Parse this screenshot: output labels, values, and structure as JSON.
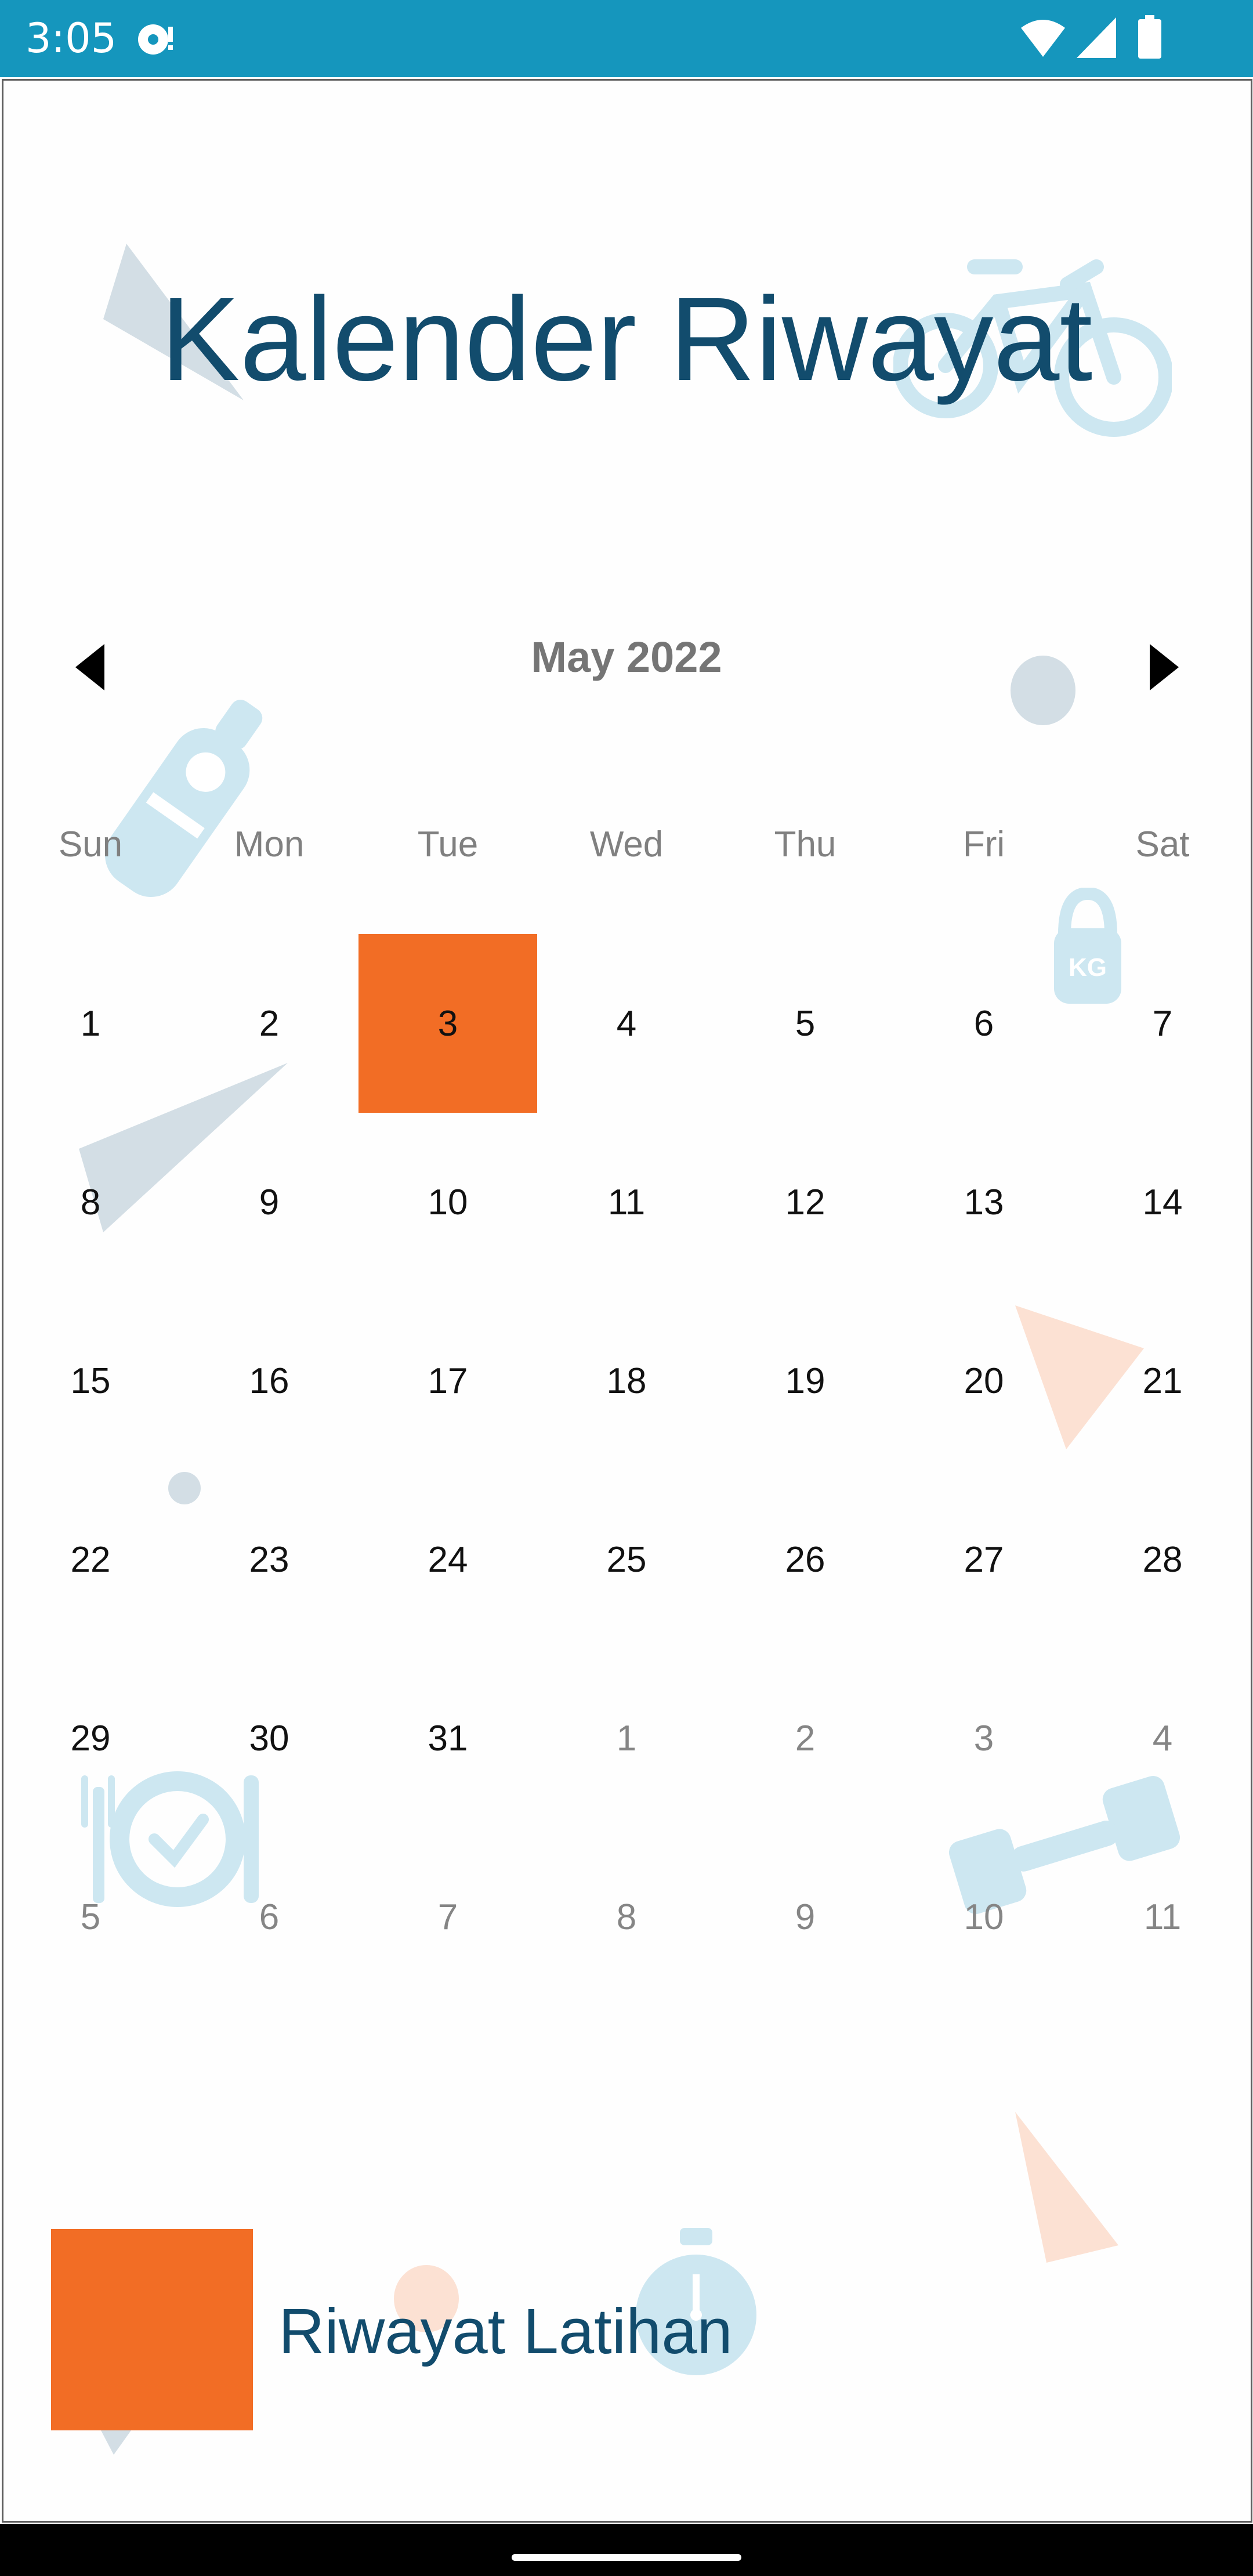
{
  "status_bar": {
    "time": "3:05",
    "icons": [
      "media-indicator-icon",
      "wifi-icon",
      "signal-icon",
      "battery-icon"
    ],
    "background": "#1596bd"
  },
  "page": {
    "title": "Kalender Riwayat"
  },
  "calendar": {
    "month_label": "May 2022",
    "prev_icon": "chevron-left-icon",
    "next_icon": "chevron-right-icon",
    "weekdays": [
      "Sun",
      "Mon",
      "Tue",
      "Wed",
      "Thu",
      "Fri",
      "Sat"
    ],
    "selected_day": "3",
    "selected_color": "#f26d25",
    "weeks": [
      [
        {
          "d": "1",
          "o": false
        },
        {
          "d": "2",
          "o": false
        },
        {
          "d": "3",
          "o": false
        },
        {
          "d": "4",
          "o": false
        },
        {
          "d": "5",
          "o": false
        },
        {
          "d": "6",
          "o": false
        },
        {
          "d": "7",
          "o": false
        }
      ],
      [
        {
          "d": "8",
          "o": false
        },
        {
          "d": "9",
          "o": false
        },
        {
          "d": "10",
          "o": false
        },
        {
          "d": "11",
          "o": false
        },
        {
          "d": "12",
          "o": false
        },
        {
          "d": "13",
          "o": false
        },
        {
          "d": "14",
          "o": false
        }
      ],
      [
        {
          "d": "15",
          "o": false
        },
        {
          "d": "16",
          "o": false
        },
        {
          "d": "17",
          "o": false
        },
        {
          "d": "18",
          "o": false
        },
        {
          "d": "19",
          "o": false
        },
        {
          "d": "20",
          "o": false
        },
        {
          "d": "21",
          "o": false
        }
      ],
      [
        {
          "d": "22",
          "o": false
        },
        {
          "d": "23",
          "o": false
        },
        {
          "d": "24",
          "o": false
        },
        {
          "d": "25",
          "o": false
        },
        {
          "d": "26",
          "o": false
        },
        {
          "d": "27",
          "o": false
        },
        {
          "d": "28",
          "o": false
        }
      ],
      [
        {
          "d": "29",
          "o": false
        },
        {
          "d": "30",
          "o": false
        },
        {
          "d": "31",
          "o": false
        },
        {
          "d": "1",
          "o": true
        },
        {
          "d": "2",
          "o": true
        },
        {
          "d": "3",
          "o": true
        },
        {
          "d": "4",
          "o": true
        }
      ],
      [
        {
          "d": "5",
          "o": true
        },
        {
          "d": "6",
          "o": true
        },
        {
          "d": "7",
          "o": true
        },
        {
          "d": "8",
          "o": true
        },
        {
          "d": "9",
          "o": true
        },
        {
          "d": "10",
          "o": true
        },
        {
          "d": "11",
          "o": true
        }
      ]
    ]
  },
  "legend": {
    "label": "Riwayat Latihan",
    "color": "#f26d25"
  },
  "decorations": [
    "bicycle-icon",
    "kettlebell-icon",
    "plate-cutlery-icon",
    "dumbbell-icon",
    "stopwatch-icon",
    "weight-scale-icon"
  ]
}
